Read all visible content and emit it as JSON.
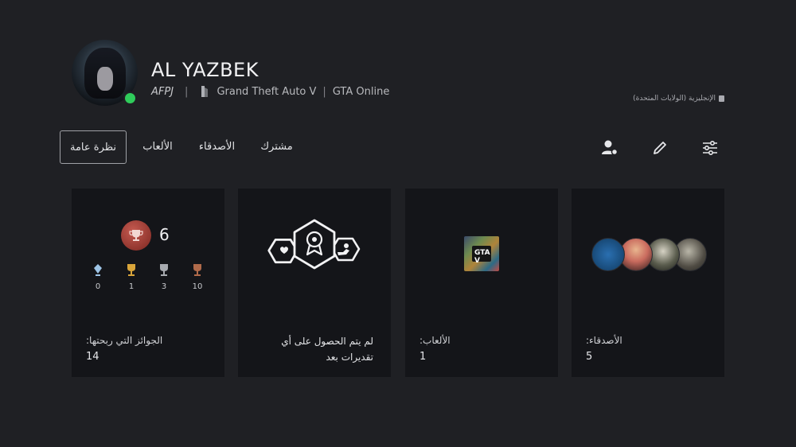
{
  "profile": {
    "name": "AL YAZBEK",
    "online_id": "AFPJ",
    "separator": "|",
    "now_playing": "Grand Theft Auto V",
    "now_playing_separator": "|",
    "mode": "GTA Online",
    "status_color": "#2fcc5b",
    "language": "الإنجليزية (الولايات المتحدة)"
  },
  "nav": {
    "tabs": [
      {
        "label": "نظرة عامة",
        "active": true
      },
      {
        "label": "الألعاب"
      },
      {
        "label": "الأصدقاء"
      },
      {
        "label": "مشترك"
      }
    ]
  },
  "toolbar": {
    "icons": [
      "friend-request-icon",
      "edit-icon",
      "settings-sliders-icon"
    ]
  },
  "cards": {
    "trophies": {
      "level": "6",
      "platinum": "0",
      "gold": "1",
      "silver": "3",
      "bronze": "10",
      "label": "الجوائز التي ربحتها:",
      "total": "14"
    },
    "badges": {
      "text": "لم يتم الحصول على أي تقديرات بعد"
    },
    "games": {
      "label": "الألعاب:",
      "value": "1",
      "thumb_text": "GTA V"
    },
    "friends": {
      "label": "الأصدقاء:",
      "value": "5"
    }
  }
}
